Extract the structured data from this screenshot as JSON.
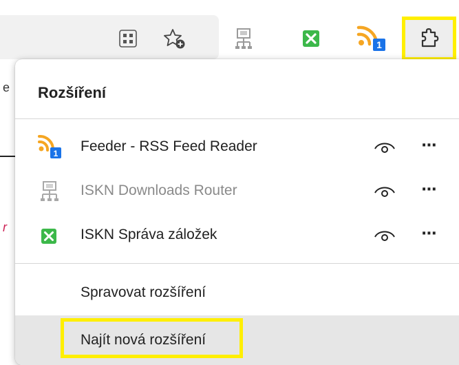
{
  "popup": {
    "title": "Rozšíření",
    "extensions": [
      {
        "name": "Feeder - RSS Feed Reader",
        "icon": "rss-feed-icon",
        "badge": "1",
        "dimmed": false
      },
      {
        "name": "ISKN Downloads Router",
        "icon": "downloads-router-icon",
        "dimmed": true
      },
      {
        "name": "ISKN Správa záložek",
        "icon": "bookmark-manager-icon",
        "dimmed": false
      }
    ],
    "more_glyph": "⋯",
    "manage_label": "Spravovat rozšíření",
    "find_label": "Najít nová rozšíření"
  },
  "toolbar": {
    "feeder_badge": "1",
    "icons": [
      "app-grid-icon",
      "add-favorite-icon",
      "downloads-router-icon",
      "bookmark-manager-icon",
      "rss-feed-icon",
      "extensions-puzzle-icon"
    ]
  },
  "background": {
    "letter_e": "e",
    "letter_r": "r"
  },
  "colors": {
    "highlight": "#ffef00",
    "rss_orange": "#f5a623",
    "badge_blue": "#1a73e8",
    "bookmark_green": "#3cb84a"
  }
}
